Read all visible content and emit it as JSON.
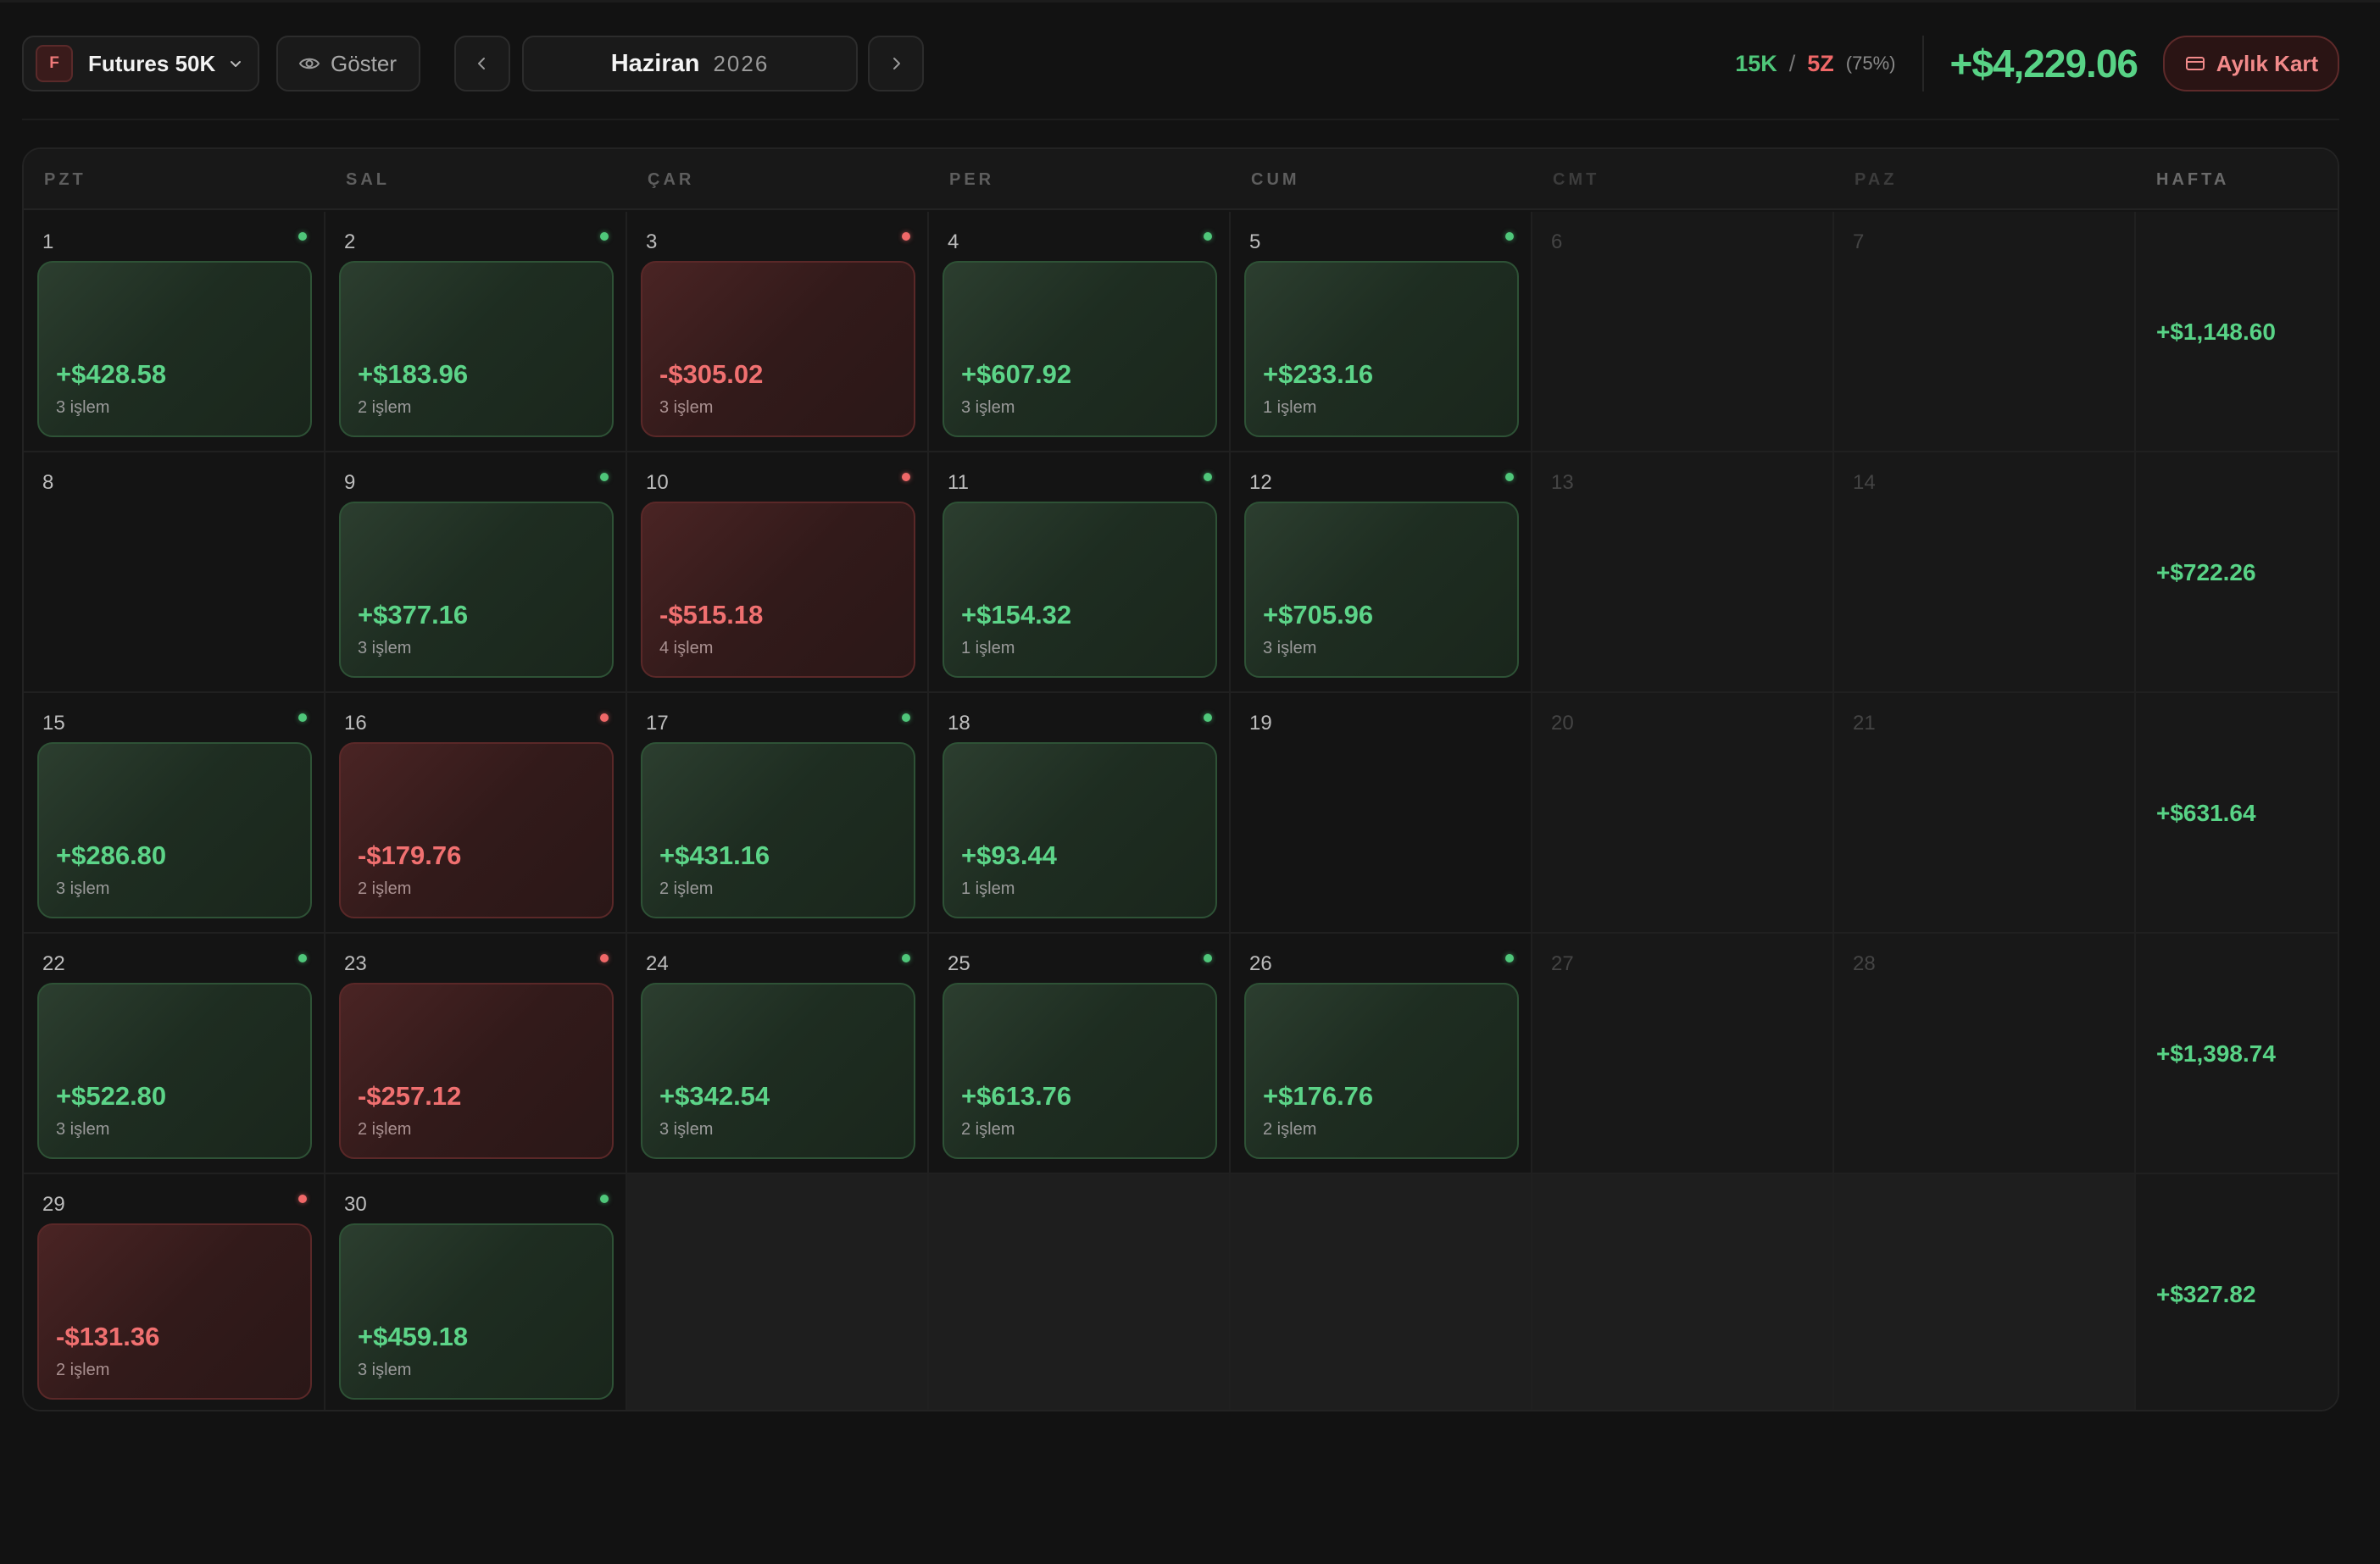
{
  "toolbar": {
    "account": {
      "badge": "F",
      "name": "Futures 50K"
    },
    "show_label": "Göster",
    "month": "Haziran",
    "year": "2026",
    "stats": {
      "wins": "15K",
      "sep": "/",
      "losses": "5Z",
      "rate": "(75%)"
    },
    "total": "+$4,229.06",
    "card_button": "Aylık Kart"
  },
  "colors": {
    "profit": "#58d386",
    "loss": "#f06868",
    "background": "#121212"
  },
  "days_header": [
    "PZT",
    "SAL",
    "ÇAR",
    "PER",
    "CUM",
    "CMT",
    "PAZ"
  ],
  "week_header": "HAFTA",
  "weeks": [
    {
      "total": "+$1,148.60",
      "days": [
        {
          "num": "1",
          "pnl": "+$428.58",
          "trades": "3 işlem",
          "result": "win"
        },
        {
          "num": "2",
          "pnl": "+$183.96",
          "trades": "2 işlem",
          "result": "win"
        },
        {
          "num": "3",
          "pnl": "-$305.02",
          "trades": "3 işlem",
          "result": "loss"
        },
        {
          "num": "4",
          "pnl": "+$607.92",
          "trades": "3 işlem",
          "result": "win"
        },
        {
          "num": "5",
          "pnl": "+$233.16",
          "trades": "1 işlem",
          "result": "win"
        },
        {
          "num": "6"
        },
        {
          "num": "7"
        }
      ]
    },
    {
      "total": "+$722.26",
      "days": [
        {
          "num": "8"
        },
        {
          "num": "9",
          "pnl": "+$377.16",
          "trades": "3 işlem",
          "result": "win"
        },
        {
          "num": "10",
          "pnl": "-$515.18",
          "trades": "4 işlem",
          "result": "loss"
        },
        {
          "num": "11",
          "pnl": "+$154.32",
          "trades": "1 işlem",
          "result": "win"
        },
        {
          "num": "12",
          "pnl": "+$705.96",
          "trades": "3 işlem",
          "result": "win"
        },
        {
          "num": "13"
        },
        {
          "num": "14"
        }
      ]
    },
    {
      "total": "+$631.64",
      "days": [
        {
          "num": "15",
          "pnl": "+$286.80",
          "trades": "3 işlem",
          "result": "win"
        },
        {
          "num": "16",
          "pnl": "-$179.76",
          "trades": "2 işlem",
          "result": "loss"
        },
        {
          "num": "17",
          "pnl": "+$431.16",
          "trades": "2 işlem",
          "result": "win"
        },
        {
          "num": "18",
          "pnl": "+$93.44",
          "trades": "1 işlem",
          "result": "win"
        },
        {
          "num": "19"
        },
        {
          "num": "20"
        },
        {
          "num": "21"
        }
      ]
    },
    {
      "total": "+$1,398.74",
      "days": [
        {
          "num": "22",
          "pnl": "+$522.80",
          "trades": "3 işlem",
          "result": "win"
        },
        {
          "num": "23",
          "pnl": "-$257.12",
          "trades": "2 işlem",
          "result": "loss"
        },
        {
          "num": "24",
          "pnl": "+$342.54",
          "trades": "3 işlem",
          "result": "win"
        },
        {
          "num": "25",
          "pnl": "+$613.76",
          "trades": "2 işlem",
          "result": "win"
        },
        {
          "num": "26",
          "pnl": "+$176.76",
          "trades": "2 işlem",
          "result": "win"
        },
        {
          "num": "27"
        },
        {
          "num": "28"
        }
      ]
    },
    {
      "total": "+$327.82",
      "days": [
        {
          "num": "29",
          "pnl": "-$131.36",
          "trades": "2 işlem",
          "result": "loss"
        },
        {
          "num": "30",
          "pnl": "+$459.18",
          "trades": "3 işlem",
          "result": "win"
        },
        {},
        {},
        {},
        {},
        {}
      ]
    }
  ]
}
